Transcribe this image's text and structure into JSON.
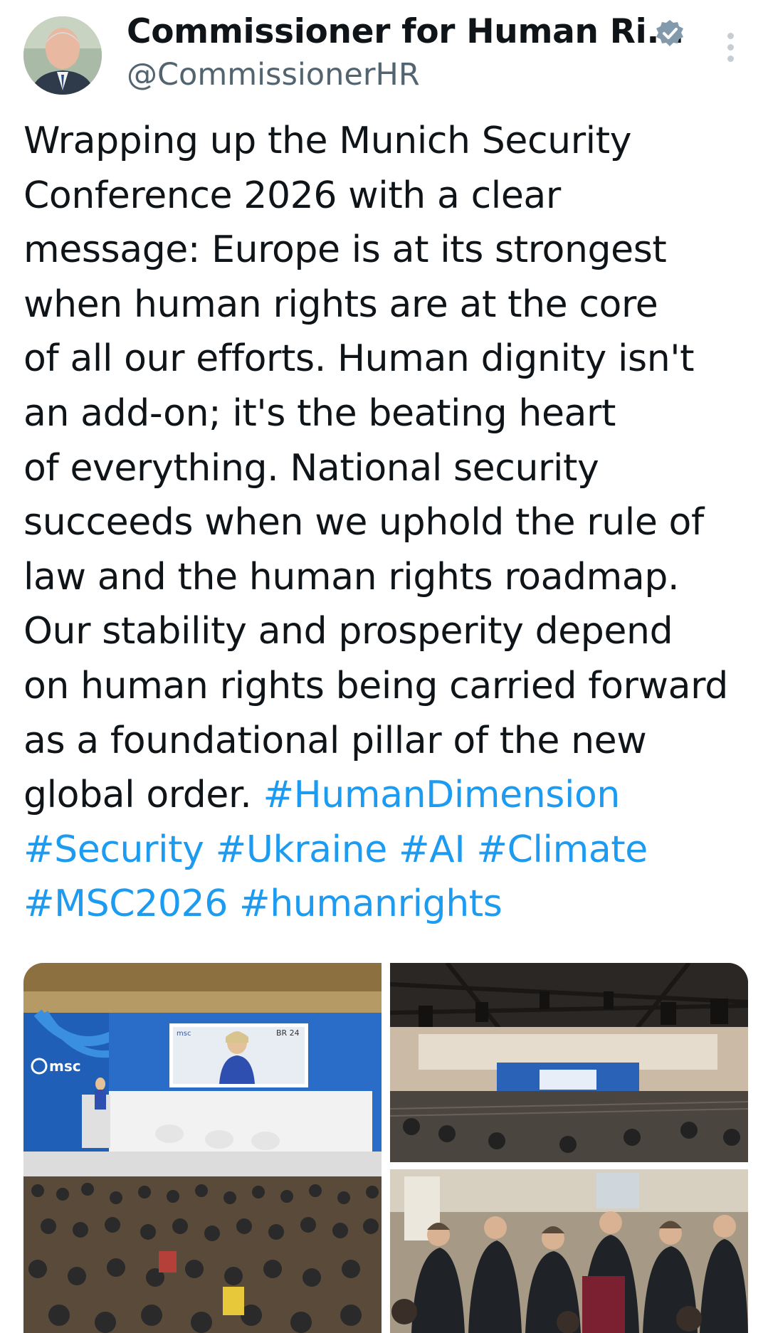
{
  "account": {
    "display_name": "Commissioner for Human Ri...",
    "handle": "@CommissionerHR",
    "verified": true
  },
  "tweet": {
    "lines": [
      "Wrapping up the Munich Security",
      "Conference 2026 with a clear",
      "message: Europe is at its strongest",
      "when human rights are at the core",
      "of all our efforts. Human dignity isn't",
      "an add-on; it's the beating heart",
      "of everything. National security",
      "succeeds when we uphold the rule of",
      "law and the human rights roadmap.",
      "Our stability and prosperity depend",
      "on human rights being carried forward",
      "as a foundational pillar of the new"
    ],
    "line13_text": "global order. ",
    "hashtags": {
      "human_dimension": "#HumanDimension",
      "security": "#Security",
      "ukraine": "#Ukraine",
      "ai": "#AI",
      "climate": "#Climate",
      "msc2026": "#MSC2026",
      "humanrights": "#humanrights"
    }
  },
  "media": {
    "photo1": {
      "stage_logo": "msc",
      "screen_logo": "msc",
      "channel_tag": "BR 24"
    }
  },
  "colors": {
    "text": "#0f1419",
    "secondary": "#536471",
    "link": "#1d9bf0",
    "verified_badge": "#829aab"
  },
  "icons": {
    "verified": "verified-badge-icon",
    "more": "more-options-icon"
  }
}
